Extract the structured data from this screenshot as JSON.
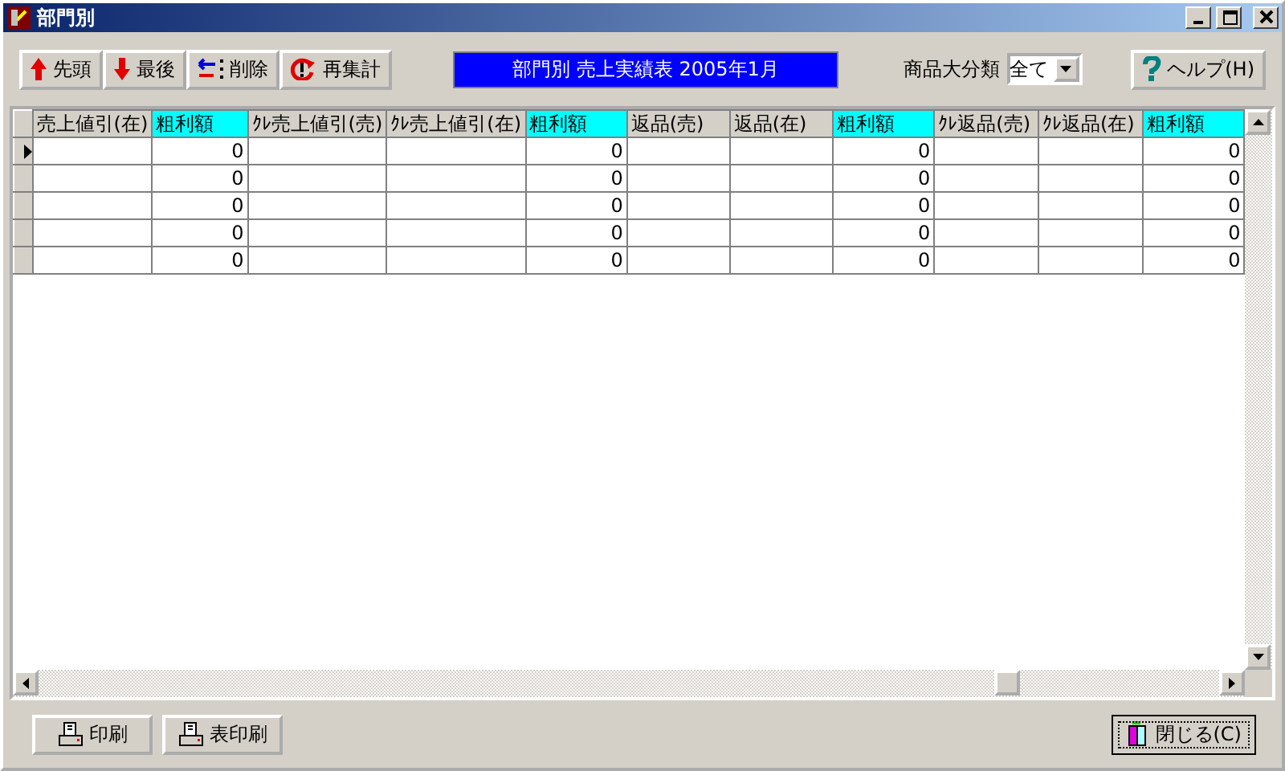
{
  "window": {
    "title": "部門別"
  },
  "toolbar": {
    "buttons": [
      {
        "label": "先頭",
        "kind": "first"
      },
      {
        "label": "最後",
        "kind": "last"
      },
      {
        "label": "削除",
        "kind": "delete"
      },
      {
        "label": "再集計",
        "kind": "recalc"
      }
    ],
    "report_title": "部門別  売上実績表 2005年1月",
    "category": {
      "label": "商品大分類",
      "value": "全て"
    },
    "help_button": "ヘルプ(H)"
  },
  "grid": {
    "columns": [
      {
        "label": "売上値引(在)",
        "highlighted": false
      },
      {
        "label": "粗利額",
        "highlighted": true
      },
      {
        "label": "ｸﾚ売上値引(売)",
        "highlighted": false
      },
      {
        "label": "ｸﾚ売上値引(在)",
        "highlighted": false
      },
      {
        "label": "粗利額",
        "highlighted": true
      },
      {
        "label": "返品(売)",
        "highlighted": false
      },
      {
        "label": "返品(在)",
        "highlighted": false
      },
      {
        "label": "粗利額",
        "highlighted": true
      },
      {
        "label": "ｸﾚ返品(売)",
        "highlighted": false
      },
      {
        "label": "ｸﾚ返品(在)",
        "highlighted": false
      },
      {
        "label": "粗利額",
        "highlighted": true
      }
    ],
    "rows": [
      {
        "selected": true,
        "cells": [
          null,
          "0",
          null,
          null,
          "0",
          null,
          null,
          "0",
          null,
          null,
          "0"
        ]
      },
      {
        "selected": false,
        "cells": [
          null,
          "0",
          null,
          null,
          "0",
          null,
          null,
          "0",
          null,
          null,
          "0"
        ]
      },
      {
        "selected": false,
        "cells": [
          null,
          "0",
          null,
          null,
          "0",
          null,
          null,
          "0",
          null,
          null,
          "0"
        ]
      },
      {
        "selected": false,
        "cells": [
          null,
          "0",
          null,
          null,
          "0",
          null,
          null,
          "0",
          null,
          null,
          "0"
        ]
      },
      {
        "selected": false,
        "cells": [
          null,
          "0",
          null,
          null,
          "0",
          null,
          null,
          "0",
          null,
          null,
          "0"
        ]
      }
    ]
  },
  "footer": {
    "buttons": [
      {
        "label": "印刷"
      },
      {
        "label": "表印刷"
      }
    ],
    "close_button": "閉じる(C)"
  }
}
